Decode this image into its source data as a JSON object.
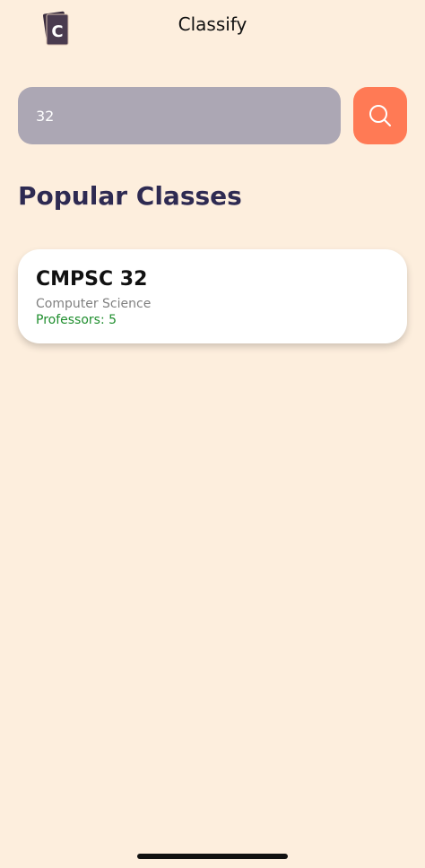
{
  "app": {
    "title": "Classify",
    "logo_letter": "C"
  },
  "search": {
    "value": "32",
    "button_icon": "search-icon"
  },
  "section": {
    "title": "Popular Classes"
  },
  "classes": [
    {
      "code": "CMPSC 32",
      "department": "Computer Science",
      "professors": "Professors: 5"
    }
  ],
  "colors": {
    "background": "#FDEEDD",
    "search_field": "#ACA7B4",
    "search_button": "#FF7A55",
    "section_title": "#2E2A52",
    "professors_text": "#1F8E2E"
  }
}
